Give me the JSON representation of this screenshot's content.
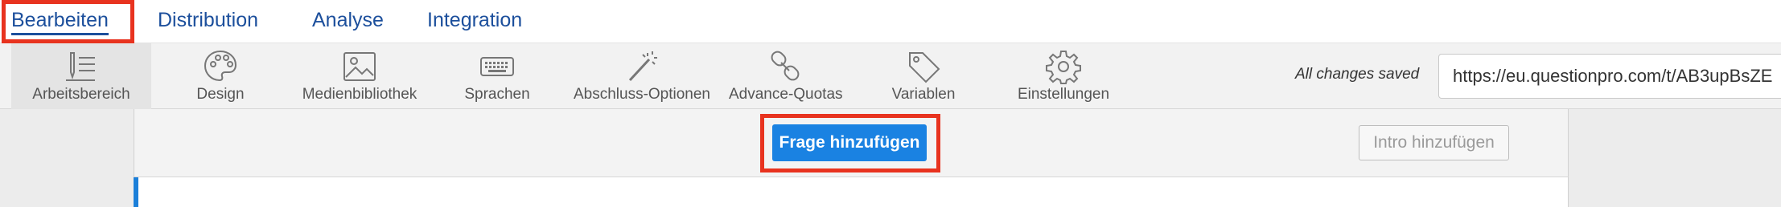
{
  "topnav": {
    "tabs": [
      {
        "label": "Bearbeiten"
      },
      {
        "label": "Distribution"
      },
      {
        "label": "Analyse"
      },
      {
        "label": "Integration"
      }
    ]
  },
  "toolbar": {
    "tools": [
      {
        "label": "Arbeitsbereich",
        "icon": "workspace-icon"
      },
      {
        "label": "Design",
        "icon": "palette-icon"
      },
      {
        "label": "Medienbibliothek",
        "icon": "image-icon"
      },
      {
        "label": "Sprachen",
        "icon": "keyboard-icon"
      },
      {
        "label": "Abschluss-Optionen",
        "icon": "magic-wand-icon"
      },
      {
        "label": "Advance-Quotas",
        "icon": "link-icon"
      },
      {
        "label": "Variablen",
        "icon": "tag-icon"
      },
      {
        "label": "Einstellungen",
        "icon": "gear-icon"
      }
    ],
    "save_status": "All changes saved",
    "survey_url": "https://eu.questionpro.com/t/AB3upBsZE"
  },
  "canvas": {
    "add_question_label": "Frage hinzufügen",
    "add_intro_label": "Intro hinzufügen"
  },
  "colors": {
    "nav_text": "#1c4f9c",
    "primary": "#1a82e2",
    "highlight": "#e8331f",
    "accent_bar": "#1b7fd9"
  }
}
